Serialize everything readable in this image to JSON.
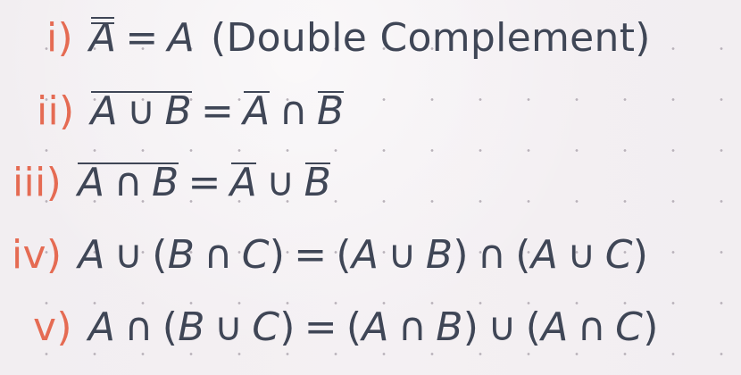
{
  "items": [
    {
      "number": "i)",
      "variable": "A",
      "equals": "=",
      "rhs": "A",
      "description": "(Double Complement)"
    },
    {
      "number": "ii)",
      "lhs_left": "A",
      "lhs_operator": "∪",
      "lhs_right": "B",
      "equals": "=",
      "rhs_left": "A",
      "rhs_operator": "∩",
      "rhs_right": "B"
    },
    {
      "number": "iii)",
      "lhs_left": "A",
      "lhs_operator": "∩",
      "lhs_right": "B",
      "equals": "=",
      "rhs_left": "A",
      "rhs_operator": "∪",
      "rhs_right": "B"
    },
    {
      "number": "iv)",
      "a": "A",
      "union": "∪",
      "open_paren": "(",
      "b": "B",
      "intersection": "∩",
      "c": "C",
      "close_paren": ")",
      "equals": "=",
      "r_open1": "(",
      "ra": "A",
      "runion1": "∪",
      "rb": "B",
      "r_close1": ")",
      "rintersection": "∩",
      "r_open2": "(",
      "ra2": "A",
      "runion2": "∪",
      "rc": "C",
      "r_close2": ")"
    },
    {
      "number": "v)",
      "a": "A",
      "intersection": "∩",
      "open_paren": "(",
      "b": "B",
      "union": "∪",
      "c": "C",
      "close_paren": ")",
      "equals": "=",
      "r_open1": "(",
      "ra": "A",
      "rintersection1": "∩",
      "rb": "B",
      "r_close1": ")",
      "runion": "∪",
      "r_open2": "(",
      "ra2": "A",
      "rintersection2": "∩",
      "rc": "C",
      "r_close2": ")"
    }
  ]
}
